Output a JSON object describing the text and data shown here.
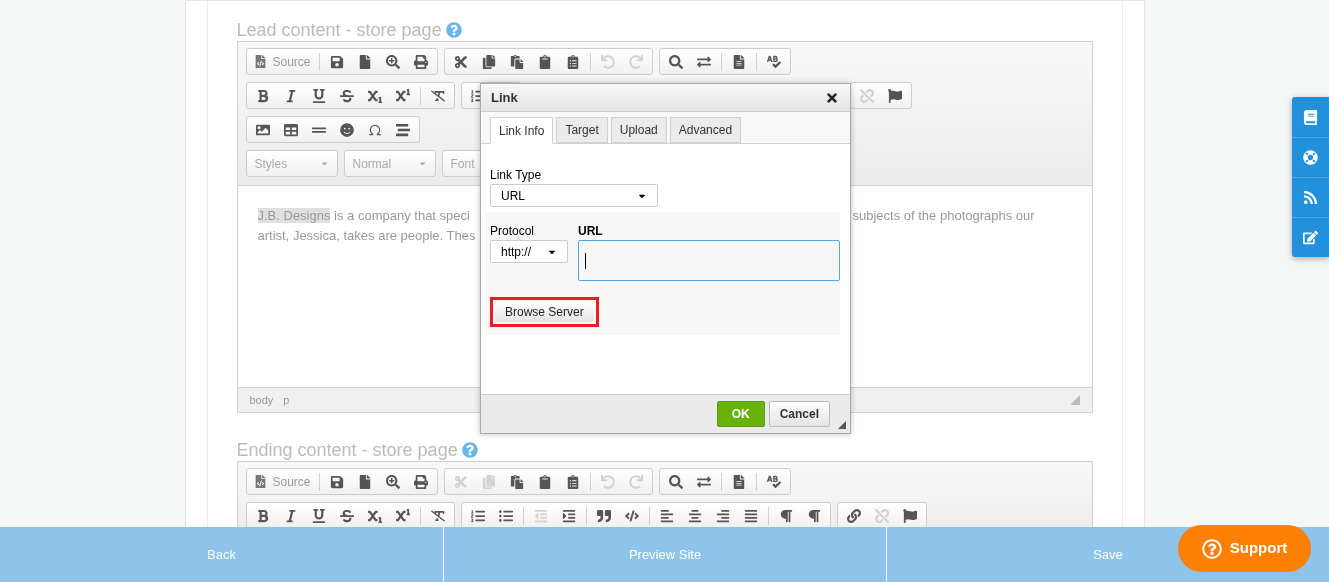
{
  "sections": [
    {
      "heading": "Lead content - store page",
      "editor": {
        "toolbar_rows": [
          [
            {
              "items": [
                {
                  "kind": "source",
                  "label": "Source",
                  "disabled": false
                },
                {
                  "kind": "separator"
                },
                {
                  "kind": "save",
                  "disabled": false
                },
                {
                  "kind": "newpage",
                  "disabled": false
                },
                {
                  "kind": "preview",
                  "disabled": false
                },
                {
                  "kind": "print",
                  "disabled": false
                }
              ]
            },
            {
              "items": [
                {
                  "kind": "cut",
                  "disabled": false
                },
                {
                  "kind": "copy",
                  "disabled": false
                },
                {
                  "kind": "paste",
                  "disabled": false
                },
                {
                  "kind": "pastetext",
                  "disabled": false
                },
                {
                  "kind": "pasteword",
                  "disabled": false
                },
                {
                  "kind": "separator"
                },
                {
                  "kind": "undo",
                  "disabled": true
                },
                {
                  "kind": "redo",
                  "disabled": true
                }
              ]
            },
            {
              "items": [
                {
                  "kind": "find",
                  "disabled": false
                },
                {
                  "kind": "replace",
                  "disabled": false
                },
                {
                  "kind": "separator"
                },
                {
                  "kind": "selectall",
                  "disabled": false
                },
                {
                  "kind": "separator"
                },
                {
                  "kind": "spellcheck",
                  "disabled": false
                }
              ]
            }
          ],
          [
            {
              "items": [
                {
                  "kind": "bold",
                  "disabled": false
                },
                {
                  "kind": "italic",
                  "disabled": false
                },
                {
                  "kind": "underline",
                  "disabled": false
                },
                {
                  "kind": "strike",
                  "disabled": false
                },
                {
                  "kind": "subscript",
                  "disabled": false
                },
                {
                  "kind": "superscript",
                  "disabled": false
                },
                {
                  "kind": "separator"
                },
                {
                  "kind": "removeformat",
                  "disabled": false
                }
              ]
            },
            {
              "items": [
                {
                  "kind": "numberedlist",
                  "disabled": false
                }
              ]
            },
            {
              "items": [
                {
                  "kind": "unlink",
                  "disabled": true
                },
                {
                  "kind": "anchor",
                  "disabled": false
                }
              ]
            }
          ],
          [
            {
              "items": [
                {
                  "kind": "image",
                  "disabled": false
                },
                {
                  "kind": "table",
                  "disabled": false
                },
                {
                  "kind": "rule",
                  "disabled": false
                },
                {
                  "kind": "smiley",
                  "disabled": false
                },
                {
                  "kind": "specialchar",
                  "disabled": false
                },
                {
                  "kind": "pagebreak",
                  "disabled": false
                }
              ]
            }
          ],
          [
            {
              "items": [
                {
                  "kind": "combo",
                  "label": "Styles",
                  "caret": true
                }
              ]
            },
            {
              "items": [
                {
                  "kind": "combo",
                  "label": "Normal",
                  "caret": true
                }
              ]
            },
            {
              "items": [
                {
                  "kind": "combo",
                  "label": "Font"
                }
              ]
            }
          ]
        ],
        "content": {
          "highlight": "J.B. Designs",
          "line_1_left": " is a company that speci",
          "line_1_right": "subjects of the photographs our",
          "line_2_left": "artist, Jessica, takes are people. Thes"
        },
        "path": [
          "body",
          "p"
        ]
      }
    },
    {
      "heading": "Ending content - store page",
      "editor": {
        "toolbar_rows": [
          [
            {
              "items": [
                {
                  "kind": "source",
                  "label": "Source",
                  "disabled": false
                },
                {
                  "kind": "separator"
                },
                {
                  "kind": "save",
                  "disabled": false
                },
                {
                  "kind": "newpage",
                  "disabled": false
                },
                {
                  "kind": "preview",
                  "disabled": false
                },
                {
                  "kind": "print",
                  "disabled": false
                }
              ]
            },
            {
              "items": [
                {
                  "kind": "cut",
                  "disabled": true
                },
                {
                  "kind": "copy",
                  "disabled": true
                },
                {
                  "kind": "paste",
                  "disabled": false
                },
                {
                  "kind": "pastetext",
                  "disabled": false
                },
                {
                  "kind": "pasteword",
                  "disabled": false
                },
                {
                  "kind": "separator"
                },
                {
                  "kind": "undo",
                  "disabled": true
                },
                {
                  "kind": "redo",
                  "disabled": true
                }
              ]
            },
            {
              "items": [
                {
                  "kind": "find",
                  "disabled": false
                },
                {
                  "kind": "replace",
                  "disabled": false
                },
                {
                  "kind": "separator"
                },
                {
                  "kind": "selectall",
                  "disabled": false
                },
                {
                  "kind": "separator"
                },
                {
                  "kind": "spellcheck",
                  "disabled": false
                }
              ]
            }
          ],
          [
            {
              "items": [
                {
                  "kind": "bold",
                  "disabled": false
                },
                {
                  "kind": "italic",
                  "disabled": false
                },
                {
                  "kind": "underline",
                  "disabled": false
                },
                {
                  "kind": "strike",
                  "disabled": false
                },
                {
                  "kind": "subscript",
                  "disabled": false
                },
                {
                  "kind": "superscript",
                  "disabled": false
                },
                {
                  "kind": "separator"
                },
                {
                  "kind": "removeformat",
                  "disabled": false
                }
              ]
            },
            {
              "items": [
                {
                  "kind": "numberedlist",
                  "disabled": false
                },
                {
                  "kind": "bulletedlist",
                  "disabled": false
                },
                {
                  "kind": "separator"
                },
                {
                  "kind": "outdent",
                  "disabled": true
                },
                {
                  "kind": "indent",
                  "disabled": false
                },
                {
                  "kind": "separator"
                },
                {
                  "kind": "blockquote",
                  "disabled": false
                },
                {
                  "kind": "div",
                  "disabled": false
                },
                {
                  "kind": "separator"
                },
                {
                  "kind": "alignleft",
                  "disabled": false
                },
                {
                  "kind": "aligncenter",
                  "disabled": false
                },
                {
                  "kind": "alignright",
                  "disabled": false
                },
                {
                  "kind": "justify",
                  "disabled": false
                },
                {
                  "kind": "separator"
                },
                {
                  "kind": "ltr",
                  "disabled": false
                },
                {
                  "kind": "rtl",
                  "disabled": false
                }
              ]
            },
            {
              "items": [
                {
                  "kind": "link",
                  "disabled": false
                },
                {
                  "kind": "unlink",
                  "disabled": true
                },
                {
                  "kind": "anchor",
                  "disabled": false
                }
              ]
            }
          ]
        ]
      }
    }
  ],
  "dialog": {
    "title": "Link",
    "tabs": [
      {
        "label": "Link Info",
        "selected": true
      },
      {
        "label": "Target",
        "selected": false
      },
      {
        "label": "Upload",
        "selected": false
      },
      {
        "label": "Advanced",
        "selected": false
      }
    ],
    "link_type": {
      "label": "Link Type",
      "value": "URL"
    },
    "protocol": {
      "label": "Protocol",
      "value": "http://"
    },
    "url": {
      "label": "URL",
      "focused": true
    },
    "browse_button": {
      "label": "Browse Server",
      "highlighted": true
    },
    "buttons": [
      {
        "label": "OK",
        "kind": "primary"
      },
      {
        "label": "Cancel",
        "kind": "secondary"
      }
    ]
  },
  "side_tabs": [
    {
      "kind": "book"
    },
    {
      "kind": "lifering"
    },
    {
      "kind": "rss"
    },
    {
      "kind": "edit"
    }
  ],
  "bottom_bar": [
    "Back",
    "Preview Site",
    "Save"
  ],
  "support_button": "Support"
}
